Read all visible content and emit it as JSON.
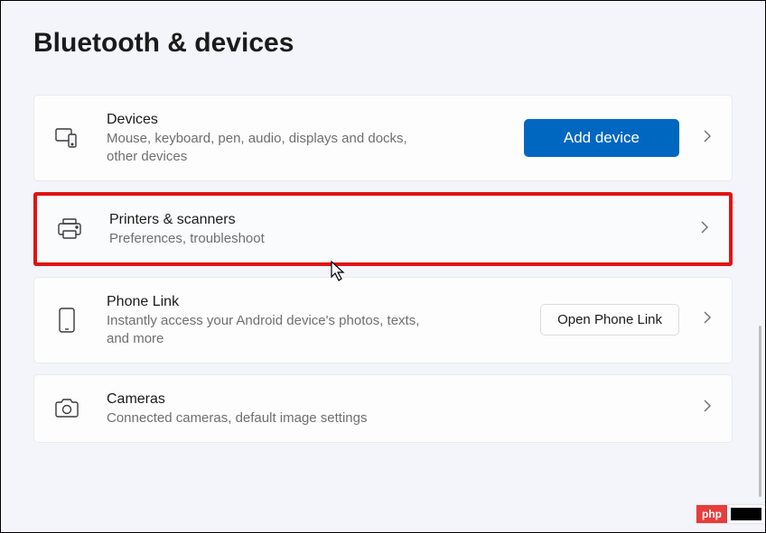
{
  "header": {
    "title": "Bluetooth & devices"
  },
  "items": [
    {
      "icon": "devices-icon",
      "title": "Devices",
      "subtitle": "Mouse, keyboard, pen, audio, displays and docks, other devices",
      "action_label": "Add device",
      "action_style": "primary"
    },
    {
      "icon": "printer-icon",
      "title": "Printers & scanners",
      "subtitle": "Preferences, troubleshoot",
      "highlighted": true
    },
    {
      "icon": "phone-icon",
      "title": "Phone Link",
      "subtitle": "Instantly access your Android device's photos, texts, and more",
      "action_label": "Open Phone Link",
      "action_style": "secondary"
    },
    {
      "icon": "camera-icon",
      "title": "Cameras",
      "subtitle": "Connected cameras, default image settings"
    }
  ],
  "watermark": {
    "text": "php"
  }
}
